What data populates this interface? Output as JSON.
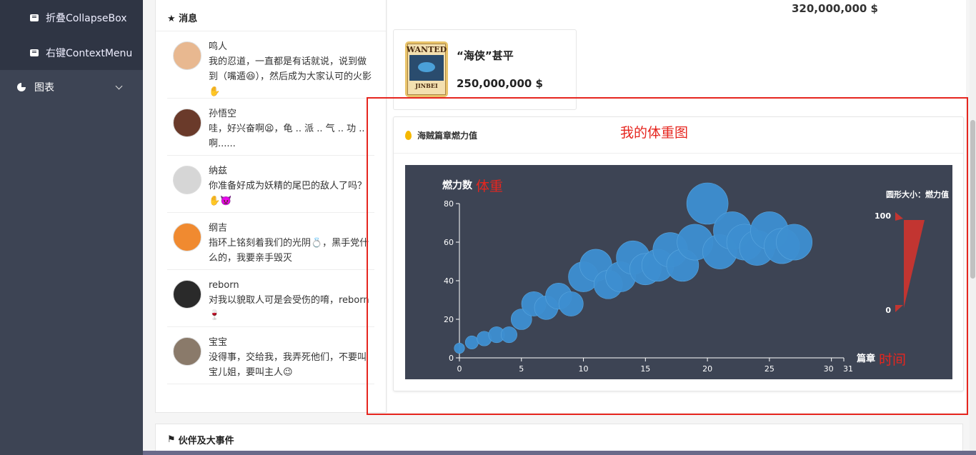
{
  "sidebar": {
    "items": [
      {
        "label": "折叠CollapseBox",
        "icon": "message-icon"
      },
      {
        "label": "右键ContextMenu",
        "icon": "message-icon"
      }
    ],
    "charts_label": "图表"
  },
  "messages": {
    "title": "★ 消息",
    "items": [
      {
        "name": "鸣人",
        "text": "我的忍道，一直都是有话就说，说到做到（嘴遁😆），然后成为大家认可的火影✋",
        "color": "#e8b890"
      },
      {
        "name": "孙悟空",
        "text": "哇，好兴奋啊😫，龟 .. 派 .. 气 .. 功 .. 啊......",
        "color": "#6a3a2a"
      },
      {
        "name": "纳兹",
        "text": "你准备好成为妖精的尾巴的敌人了吗？✋👿",
        "color": "#d6d6d6"
      },
      {
        "name": "纲吉",
        "text": "指环上铭刻着我们的光阴💍，黑手党什么的，我要亲手毁灭",
        "color": "#f08a30"
      },
      {
        "name": "reborn",
        "text": "对我以貌取人可是会受伤的唷，reborn🍷",
        "color": "#2a2a2a"
      },
      {
        "name": "宝宝",
        "text": "没得事，交给我，我弄死他们，不要叫宝儿姐，要叫主人😉",
        "color": "#8a7a6a"
      }
    ]
  },
  "top_price": "320,000,000 $",
  "card": {
    "title": "“海侠”甚平",
    "price": "250,000,000 $",
    "poster_title": "WANTED",
    "poster_name": "JINBEI"
  },
  "chart_panel": {
    "title": "海贼篇章燃力值"
  },
  "annotations": {
    "weight_chart": "我的体重图",
    "weight": "体重",
    "time": "时间"
  },
  "chart_data": {
    "type": "scatter",
    "ylabel": "燃力数",
    "xlabel": "篇章",
    "visual_map_title": "圆形大小：燃力值",
    "visual_map_range": [
      0,
      100
    ],
    "xlim": [
      0,
      31
    ],
    "ylim": [
      0,
      80
    ],
    "x_ticks": [
      0,
      5,
      10,
      15,
      20,
      25,
      30,
      31
    ],
    "y_ticks": [
      0,
      20,
      40,
      60,
      80
    ],
    "x": [
      0,
      1,
      2,
      3,
      4,
      5,
      6,
      7,
      8,
      9,
      10,
      11,
      12,
      13,
      14,
      15,
      16,
      17,
      18,
      19,
      20,
      21,
      22,
      23,
      24,
      25,
      26,
      27
    ],
    "y": [
      5,
      8,
      10,
      12,
      12,
      20,
      28,
      26,
      32,
      28,
      42,
      48,
      38,
      42,
      52,
      46,
      48,
      56,
      48,
      60,
      80,
      55,
      66,
      60,
      57,
      66,
      58,
      60
    ],
    "bubble_color": "#3d8fd0",
    "background": "#3d4454",
    "visual_map_color": "#c23531"
  }
}
